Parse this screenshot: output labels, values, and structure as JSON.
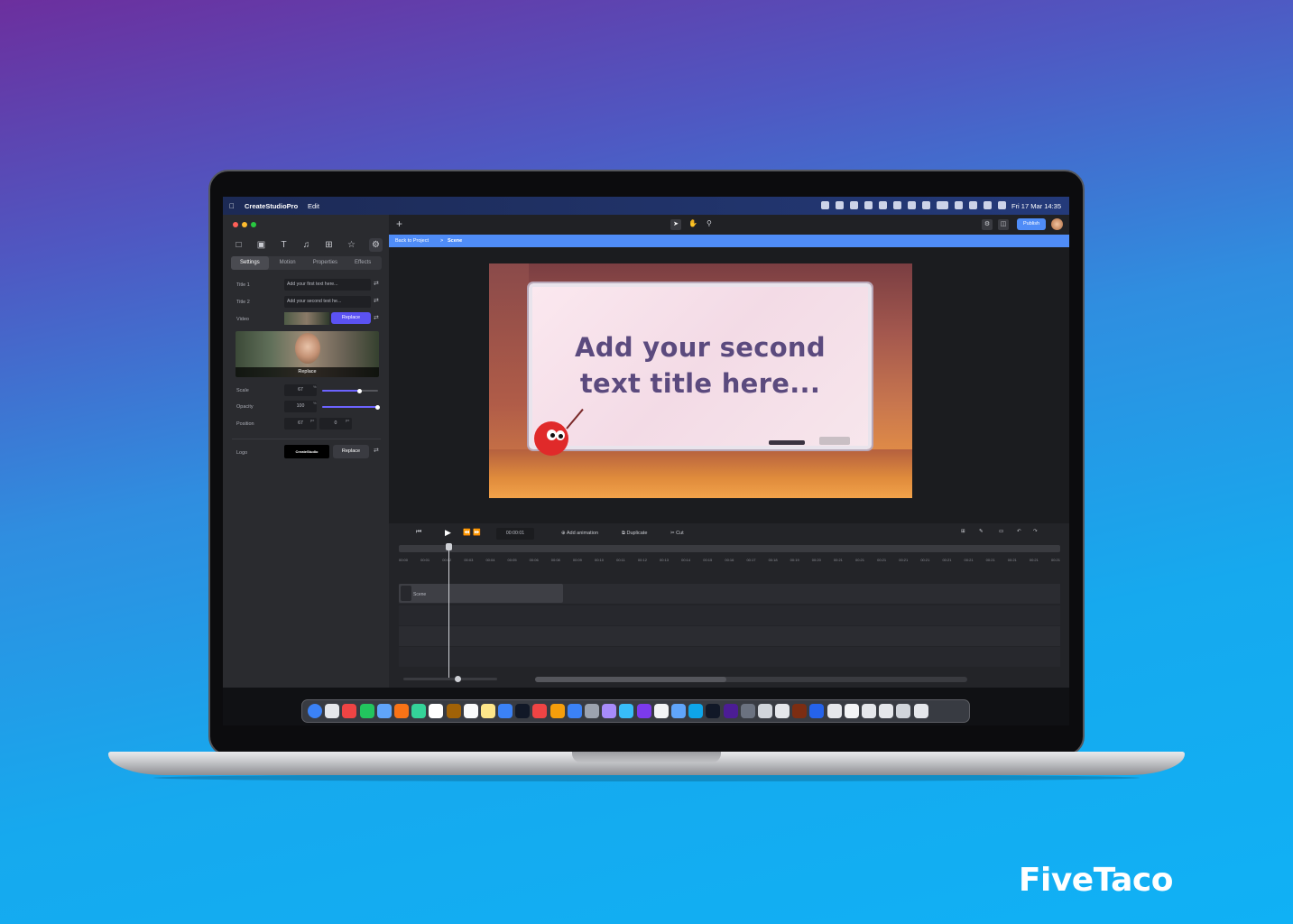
{
  "brand": {
    "watermark": "FiveTaco"
  },
  "menubar": {
    "app_name": "CreateStudioPro",
    "menu_edit": "Edit",
    "datetime": "Fri 17 Mar 14:35"
  },
  "sidebar": {
    "tabs": [
      "Settings",
      "Motion",
      "Properties",
      "Effects"
    ],
    "title1_label": "Title 1",
    "title1_value": "Add your first text here...",
    "title2_label": "Title 2",
    "title2_value": "Add your second text he...",
    "video_label": "Video",
    "replace_label": "Replace",
    "video_overlay_label": "Replace",
    "scale_label": "Scale",
    "scale_value": "67",
    "scale_unit": "%",
    "scale_level": 0.67,
    "opacity_label": "Opacity",
    "opacity_value": "100",
    "opacity_unit": "%",
    "opacity_level": 1.0,
    "position_label": "Position",
    "position_x": "67",
    "position_y": "0",
    "position_unit": "px",
    "logo_label": "Logo",
    "logo_text": "CreateStudio",
    "logo_replace": "Replace"
  },
  "topbar": {
    "publish_label": "Publish"
  },
  "breadcrumb": {
    "back": "Back to Project",
    "separator": ">",
    "current": "Scene"
  },
  "preview": {
    "line1": "Add your second",
    "line2": "text title here..."
  },
  "timeline": {
    "time": "00:00:01",
    "add_animation": "Add animation",
    "duplicate": "Duplicate",
    "cut": "Cut",
    "clip_label": "Scene",
    "ticks": [
      "00:00",
      "00:01",
      "00:02",
      "00:03",
      "00:04",
      "00:05",
      "00:06",
      "00:08",
      "00:09",
      "00:10",
      "00:11",
      "00:12",
      "00:13",
      "00:14",
      "00:15",
      "00:16",
      "00:17",
      "00:18",
      "00:19",
      "00:20",
      "00:21",
      "00:21",
      "00:21",
      "00:21",
      "00:21",
      "00:21",
      "00:21",
      "00:21",
      "00:21",
      "00:21",
      "00:21"
    ]
  },
  "dock": {
    "icon_colors": [
      "#3b82f6",
      "#e5e7eb",
      "#ef4444",
      "#22c55e",
      "#60a5fa",
      "#f97316",
      "#34d399",
      "#ffffff",
      "#a16207",
      "#f9fafb",
      "#fde68a",
      "#3b82f6",
      "#111827",
      "#ef4444",
      "#f59e0b",
      "#3b82f6",
      "#9ca3af",
      "#a78bfa",
      "#38bdf8",
      "#7c3aed",
      "#f3f4f6",
      "#60a5fa",
      "#0ea5e9",
      "#111827",
      "#4c1d95",
      "#6b7280",
      "#d1d5db",
      "#e5e7eb",
      "#7c2d12",
      "#2563eb",
      "#e5e7eb",
      "#f3f4f6",
      "#e5e7eb",
      "#e5e7eb",
      "#d1d5db",
      "#e5e7eb"
    ]
  }
}
